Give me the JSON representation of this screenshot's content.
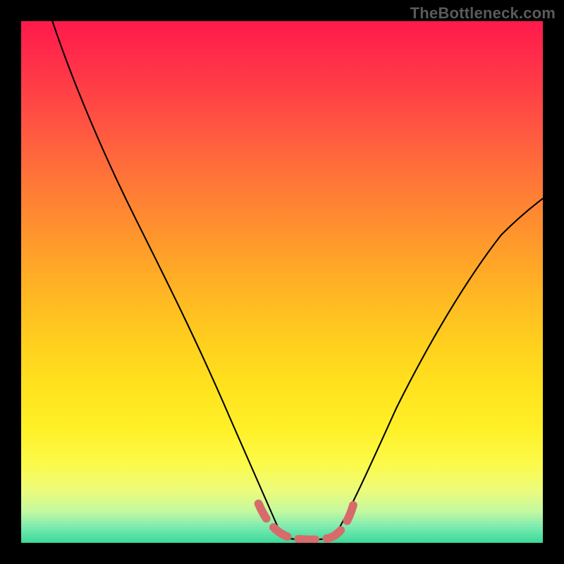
{
  "watermark": "TheBottleneck.com",
  "chart_data": {
    "type": "line",
    "title": "",
    "xlabel": "",
    "ylabel": "",
    "xlim": [
      0,
      100
    ],
    "ylim": [
      0,
      100
    ],
    "background": "heatmap-gradient",
    "gradient_stops": [
      {
        "pct": 0,
        "color": "#ff1a4b"
      },
      {
        "pct": 14,
        "color": "#ff4245"
      },
      {
        "pct": 30,
        "color": "#ff7438"
      },
      {
        "pct": 46,
        "color": "#ffa428"
      },
      {
        "pct": 62,
        "color": "#ffd01e"
      },
      {
        "pct": 78,
        "color": "#fff028"
      },
      {
        "pct": 90,
        "color": "#edfc7c"
      },
      {
        "pct": 97,
        "color": "#7bebb0"
      },
      {
        "pct": 100,
        "color": "#39d99a"
      }
    ],
    "series": [
      {
        "name": "bottleneck-curve",
        "stroke": "#000000",
        "values": [
          {
            "x": 6,
            "y": 100
          },
          {
            "x": 12,
            "y": 84
          },
          {
            "x": 20,
            "y": 68
          },
          {
            "x": 28,
            "y": 52
          },
          {
            "x": 36,
            "y": 34
          },
          {
            "x": 42,
            "y": 18
          },
          {
            "x": 47,
            "y": 6
          },
          {
            "x": 50,
            "y": 1
          },
          {
            "x": 55,
            "y": 0
          },
          {
            "x": 60,
            "y": 1
          },
          {
            "x": 63,
            "y": 5
          },
          {
            "x": 70,
            "y": 20
          },
          {
            "x": 78,
            "y": 36
          },
          {
            "x": 86,
            "y": 48
          },
          {
            "x": 94,
            "y": 58
          },
          {
            "x": 100,
            "y": 63
          }
        ]
      },
      {
        "name": "optimal-zone-marker",
        "stroke": "#d76b6b",
        "values": [
          {
            "x": 46,
            "y": 7
          },
          {
            "x": 48,
            "y": 3
          },
          {
            "x": 51,
            "y": 1
          },
          {
            "x": 55,
            "y": 0.5
          },
          {
            "x": 59,
            "y": 1
          },
          {
            "x": 62,
            "y": 3
          },
          {
            "x": 64,
            "y": 8
          }
        ]
      }
    ]
  }
}
